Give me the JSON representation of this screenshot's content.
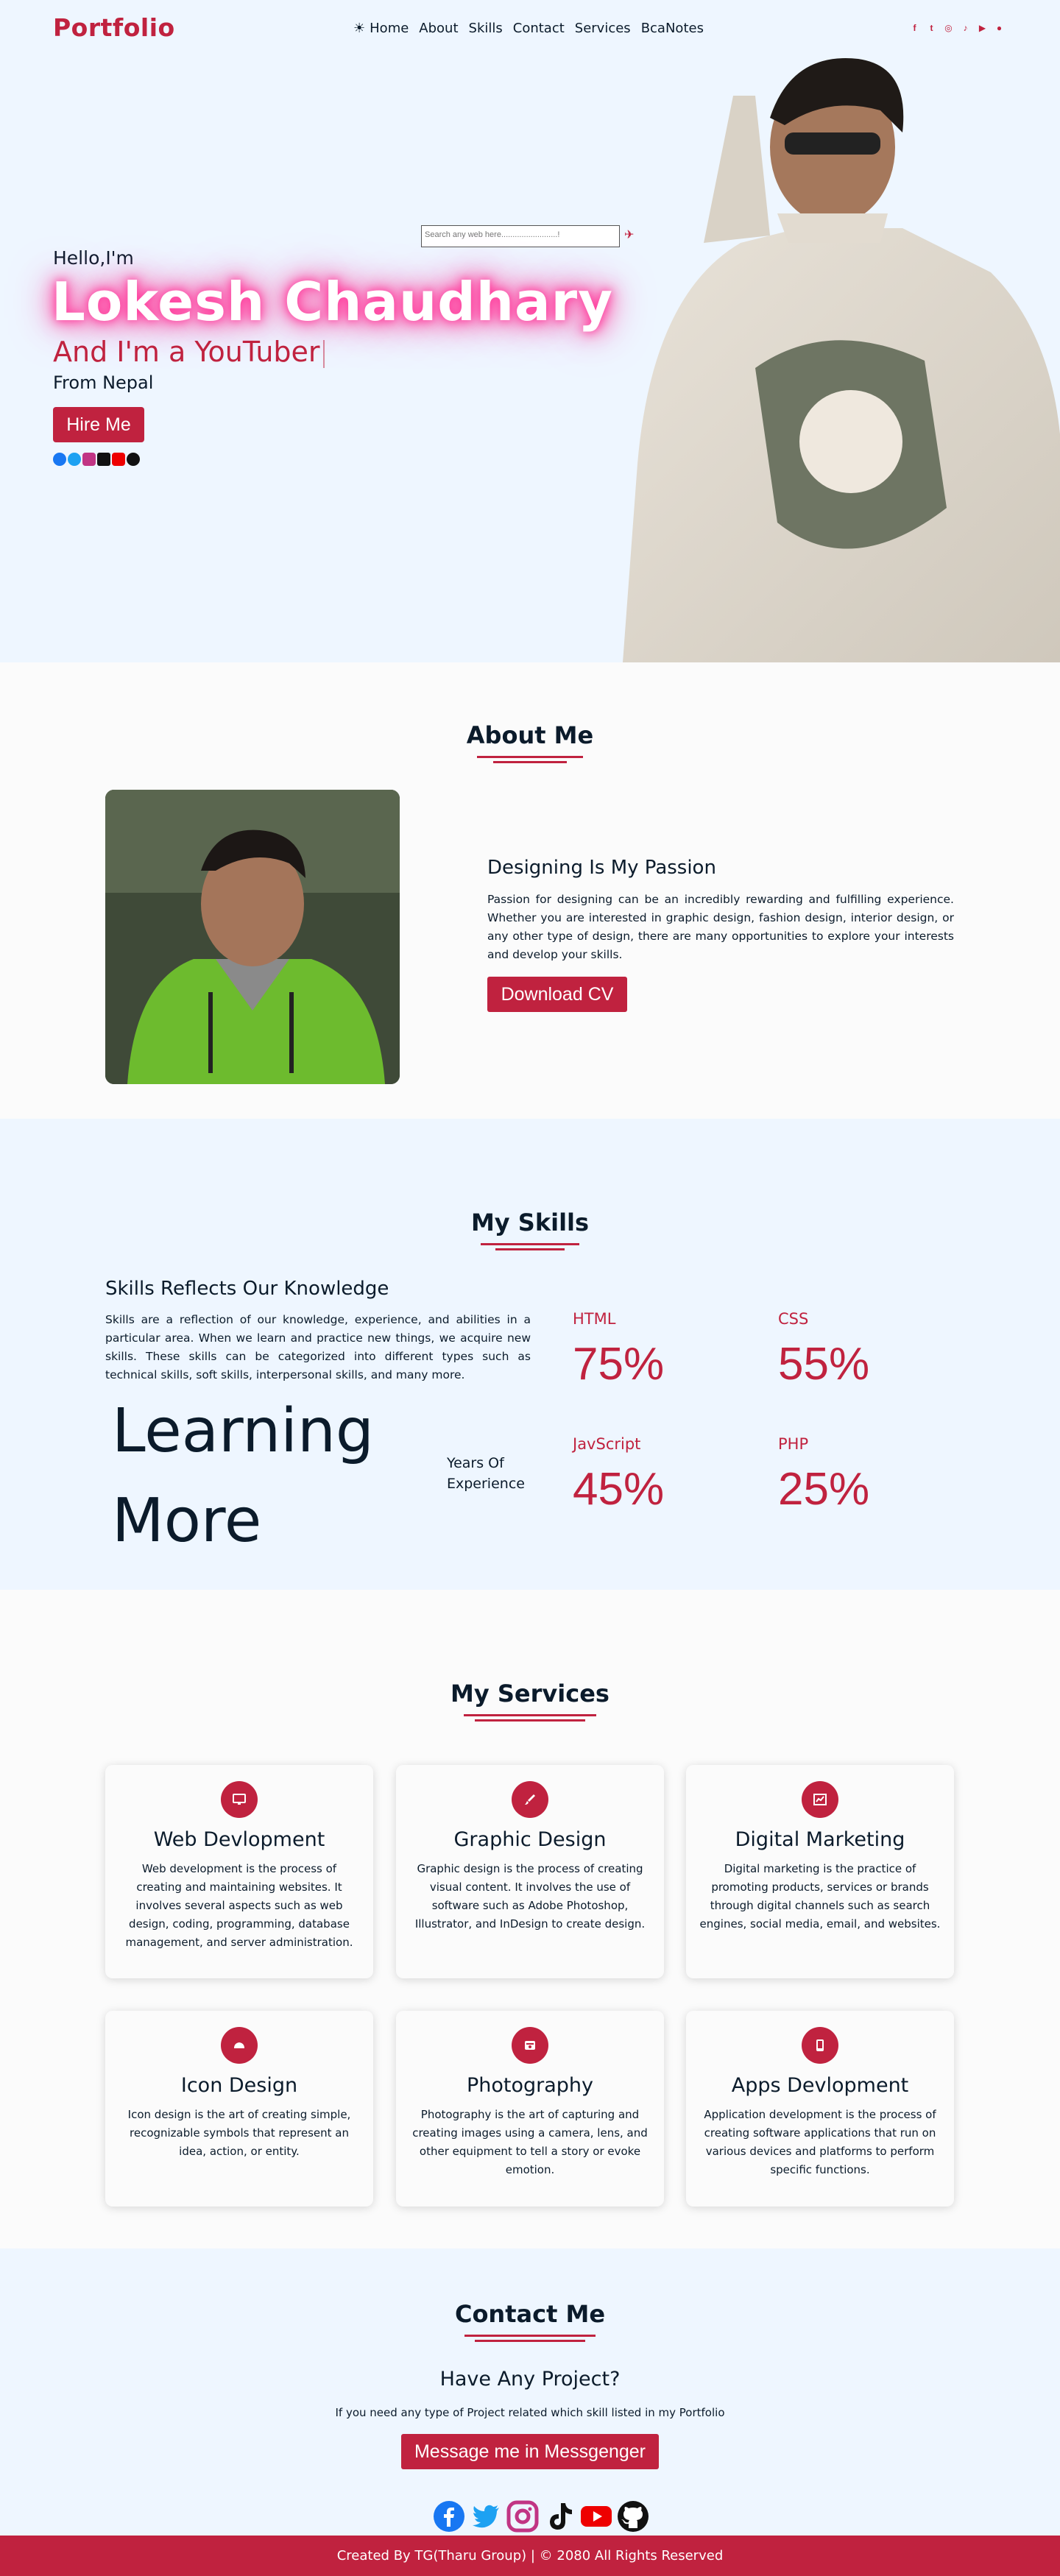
{
  "nav": {
    "logo": "Portfolio",
    "theme_icon": "☀",
    "items": [
      "Home",
      "About",
      "Skills",
      "Contact",
      "Services",
      "BcaNotes"
    ],
    "social_icons": [
      "facebook-icon",
      "twitter-icon",
      "instagram-icon",
      "tiktok-icon",
      "youtube-icon",
      "github-icon"
    ]
  },
  "hero": {
    "search_placeholder": "Search any web here.........................!",
    "greeting": "Hello,I'm",
    "name": "Lokesh Chaudhary",
    "role": "And I'm a YouTuber",
    "from": "From Nepal",
    "hire_label": "Hire Me"
  },
  "about": {
    "title": "About Me",
    "heading": "Designing Is My Passion",
    "text": "Passion for designing can be an incredibly rewarding and fulfilling experience. Whether you are interested in graphic design, fashion design, interior design, or any other type of design, there are many opportunities to explore your interests and develop your skills.",
    "download_label": "Download CV"
  },
  "skills": {
    "title": "My Skills",
    "heading": "Skills Reflects Our Knowledge",
    "text": "Skills are a reflection of our knowledge, experience, and abilities in a particular area. When we learn and practice new things, we acquire new skills. These skills can be categorized into different types such as technical skills, soft skills, interpersonal skills, and many more.",
    "learning_line1": "Learning",
    "learning_line2": "More",
    "years_label": "Years Of Experience",
    "items": [
      {
        "name": "HTML",
        "percent": "75%"
      },
      {
        "name": "CSS",
        "percent": "55%"
      },
      {
        "name": "JavScript",
        "percent": "45%"
      },
      {
        "name": "PHP",
        "percent": "25%"
      }
    ]
  },
  "services": {
    "title": "My Services",
    "items": [
      {
        "title": "Web Devlopment",
        "icon": "monitor-icon",
        "text": "Web development is the process of creating and maintaining websites. It involves several aspects such as web design, coding, programming, database management, and server administration."
      },
      {
        "title": "Graphic Design",
        "icon": "brush-icon",
        "text": "Graphic design is the process of creating visual content. It involves the use of software such as Adobe Photoshop, Illustrator, and InDesign to create design."
      },
      {
        "title": "Digital Marketing",
        "icon": "chart-icon",
        "text": "Digital marketing is the practice of promoting products, services or brands through digital channels such as search engines, social media, email, and websites."
      },
      {
        "title": "Icon Design",
        "icon": "cloud-icon",
        "text": "Icon design is the art of creating simple, recognizable symbols that represent an idea, action, or entity."
      },
      {
        "title": "Photography",
        "icon": "camera-icon",
        "text": "Photography is the art of capturing and creating images using a camera, lens, and other equipment to tell a story or evoke emotion."
      },
      {
        "title": "Apps Devlopment",
        "icon": "tablet-icon",
        "text": "Application development is the process of creating software applications that run on various devices and platforms to perform specific functions."
      }
    ]
  },
  "contact": {
    "title": "Contact Me",
    "heading": "Have Any Project?",
    "text": "If you need any type of Project related which skill listed in my Portfolio",
    "button_label": "Message me in Messgenger"
  },
  "footer": {
    "text": "Created By TG(Tharu Group) | © 2080 All Rights Reserved"
  },
  "colors": {
    "accent": "#c0223f",
    "hero_bg": "#eef6ff",
    "text": "#0b1b2b"
  }
}
